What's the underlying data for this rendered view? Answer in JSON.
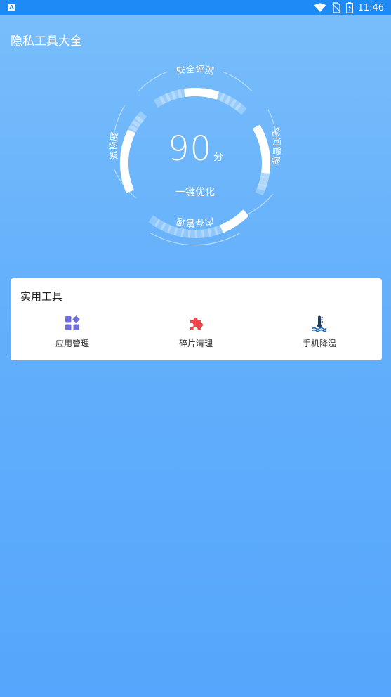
{
  "status_bar": {
    "app_icon": "A",
    "time": "11:46",
    "icons": [
      "wifi-icon",
      "no-sim-icon",
      "battery-icon"
    ]
  },
  "header": {
    "title": "隐私工具大全"
  },
  "gauge": {
    "score": "90",
    "score_unit": "分",
    "optimize_label": "一键优化",
    "labels": {
      "safety": "安全评测",
      "space": "空间管理",
      "memory": "内存管理",
      "fluency": "流畅度"
    }
  },
  "tools": {
    "title": "实用工具",
    "items": [
      {
        "label": "应用管理",
        "icon": "app-grid-icon",
        "color": "#6F6CDE"
      },
      {
        "label": "碎片清理",
        "icon": "puzzle-icon",
        "color": "#F0474E"
      },
      {
        "label": "手机降温",
        "icon": "thermometer-icon",
        "color": "#1E6FB8"
      }
    ]
  },
  "colors": {
    "status_bar": "#1E8AF6",
    "background_top": "#79BEFB",
    "background_bottom": "#55A6FC",
    "card": "#FFFFFF"
  }
}
